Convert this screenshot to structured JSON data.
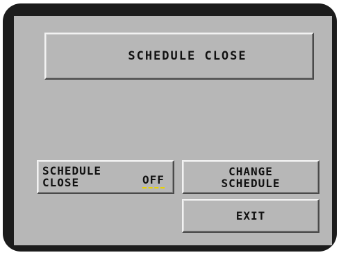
{
  "title": "SCHEDULE CLOSE",
  "status": {
    "label": "SCHEDULE\nCLOSE",
    "value": "OFF"
  },
  "buttons": {
    "change_schedule": "CHANGE\nSCHEDULE",
    "exit": "EXIT"
  },
  "colors": {
    "bezel": "#1c1c1c",
    "screen": "#b7b7b7",
    "text": "#111111",
    "value_underline": "#e8d200"
  }
}
